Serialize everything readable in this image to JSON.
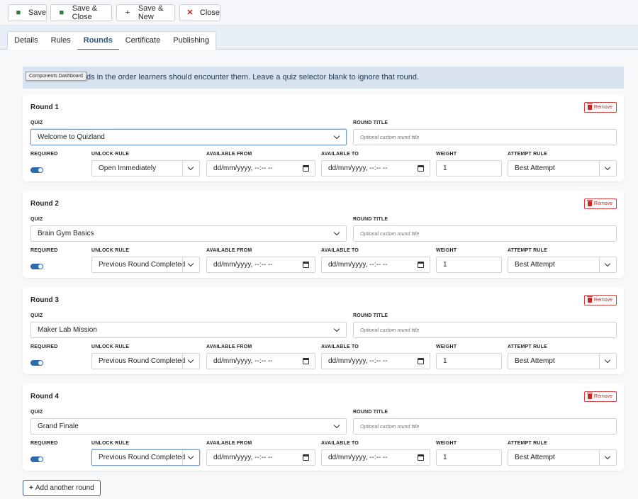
{
  "toolbar": {
    "buttons": [
      {
        "label": "Save",
        "icon": "save-icon"
      },
      {
        "label": "Save & Close",
        "icon": "save-icon"
      },
      {
        "label": "Save & New",
        "icon": "plus-icon"
      },
      {
        "label": "Close",
        "icon": "close-icon"
      }
    ]
  },
  "tabs": [
    "Details",
    "Rules",
    "Rounds",
    "Certificate",
    "Publishing"
  ],
  "active_tab": "Rounds",
  "info_text": "ds in the order learners should encounter them. Leave a quiz selector blank to ignore that round.",
  "tooltip": "Components Dashboard",
  "labels": {
    "quiz": "QUIZ",
    "round_title": "ROUND TITLE",
    "required": "REQUIRED",
    "unlock_rule": "UNLOCK RULE",
    "available_from": "AVAILABLE FROM",
    "available_to": "AVAILABLE TO",
    "weight": "WEIGHT",
    "attempt_rule": "ATTEMPT RULE",
    "remove": "Remove",
    "round_title_placeholder": "Optional custom round title"
  },
  "rounds": [
    {
      "title": "Round 1",
      "quiz": "Welcome to Quizland",
      "required": true,
      "unlock_rule": "Open Immediately",
      "available_from": "dd/mm/yyyy, --:-- --",
      "available_to": "dd/mm/yyyy, --:-- --",
      "weight": "1",
      "attempt_rule": "Best Attempt"
    },
    {
      "title": "Round 2",
      "quiz": "Brain Gym Basics",
      "required": true,
      "unlock_rule": "Previous Round Completed",
      "available_from": "dd/mm/yyyy, --:-- --",
      "available_to": "dd/mm/yyyy, --:-- --",
      "weight": "1",
      "attempt_rule": "Best Attempt"
    },
    {
      "title": "Round 3",
      "quiz": "Maker Lab Mission",
      "required": true,
      "unlock_rule": "Previous Round Completed",
      "available_from": "dd/mm/yyyy, --:-- --",
      "available_to": "dd/mm/yyyy, --:-- --",
      "weight": "1",
      "attempt_rule": "Best Attempt"
    },
    {
      "title": "Round 4",
      "quiz": "Grand Finale",
      "required": true,
      "unlock_rule": "Previous Round Completed",
      "available_from": "dd/mm/yyyy, --:-- --",
      "available_to": "dd/mm/yyyy, --:-- --",
      "weight": "1",
      "attempt_rule": "Best Attempt"
    }
  ],
  "add_button": "Add another round",
  "colors": {
    "accent": "#2b6cb0",
    "danger": "#c62828",
    "info_bg": "#d9e3ef"
  }
}
